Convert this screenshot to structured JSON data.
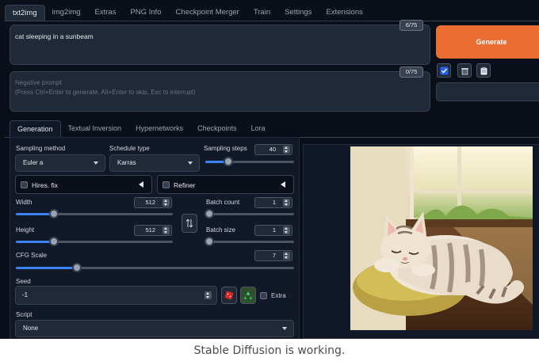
{
  "top_tabs": [
    "txt2img",
    "img2img",
    "Extras",
    "PNG Info",
    "Checkpoint Merger",
    "Train",
    "Settings",
    "Extensions"
  ],
  "prompt": {
    "value": "cat sleeping in a sunbeam",
    "token_count": "6/75"
  },
  "negative_prompt": {
    "placeholder_line1": "Negative prompt",
    "placeholder_line2": "(Press Ctrl+Enter to generate, Alt+Enter to skip, Esc to interrupt)",
    "token_count": "0/75"
  },
  "generate_label": "Generate",
  "tool_icons": [
    "checkmark-icon",
    "trash-icon",
    "clipboard-icon"
  ],
  "sub_tabs": [
    "Generation",
    "Textual Inversion",
    "Hypernetworks",
    "Checkpoints",
    "Lora"
  ],
  "sampling": {
    "method_label": "Sampling method",
    "method_value": "Euler a",
    "schedule_label": "Schedule type",
    "schedule_value": "Karras",
    "steps_label": "Sampling steps",
    "steps_value": "40",
    "steps_fraction": 0.26
  },
  "hires_label": "Hires. fix",
  "refiner_label": "Refiner",
  "width": {
    "label": "Width",
    "value": "512",
    "fraction": 0.24
  },
  "height": {
    "label": "Height",
    "value": "512",
    "fraction": 0.24
  },
  "batch_count": {
    "label": "Batch count",
    "value": "1",
    "fraction": 0.0
  },
  "batch_size": {
    "label": "Batch size",
    "value": "1",
    "fraction": 0.0
  },
  "cfg": {
    "label": "CFG Scale",
    "value": "7",
    "fraction": 0.22
  },
  "seed": {
    "label": "Seed",
    "value": "-1",
    "extra_label": "Extra"
  },
  "script": {
    "label": "Script",
    "value": "None"
  },
  "caption": "Stable Diffusion is working.",
  "colors": {
    "accent": "#ea6d32",
    "slider_fill": "#3b82f6",
    "background": "#0b0f19",
    "panel": "#1f2937"
  }
}
